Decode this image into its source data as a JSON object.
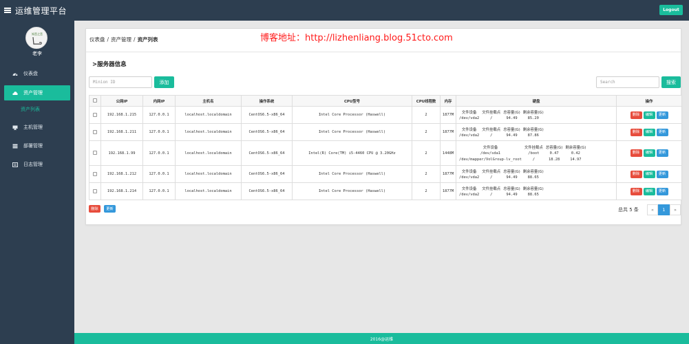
{
  "header": {
    "title": "运维管理平台",
    "logout_label": "Logout"
  },
  "sidebar": {
    "username": "老李",
    "items": [
      {
        "label": "仪表盘",
        "icon": "dashboard-icon"
      },
      {
        "label": "资产管理",
        "icon": "cloud-icon",
        "sub": "资产列表"
      },
      {
        "label": "主机管理",
        "icon": "desktop-icon"
      },
      {
        "label": "部署管理",
        "icon": "deploy-icon"
      },
      {
        "label": "日志管理",
        "icon": "log-icon"
      }
    ]
  },
  "breadcrumb": [
    "仪表盘",
    "资产管理",
    "资产列表"
  ],
  "blog_url": "博客地址：http://lizhenliang.blog.51cto.com",
  "section_title": ">服务器信息",
  "minion_input": {
    "placeholder": "Minion ID"
  },
  "add_label": "添加",
  "search_input": {
    "placeholder": "Search"
  },
  "search_label": "搜索",
  "table": {
    "columns": [
      "公网IP",
      "内网IP",
      "主机名",
      "操作系统",
      "CPU型号",
      "CPU线程数",
      "内存",
      "硬盘",
      "操作"
    ],
    "disk_headers": [
      "文件设备",
      "文件挂载点",
      "总容量(G)",
      "剩余容量(G)"
    ],
    "actions": {
      "delete": "删除",
      "edit": "编辑",
      "update": "更新"
    },
    "rows": [
      {
        "public_ip": "192.168.1.215",
        "private_ip": "127.0.0.1",
        "hostname": "localhost.localdomain",
        "os": "CentOS6.5-x86_64",
        "cpu": "Intel Core Processor (Haswell)",
        "threads": "2",
        "mem": "1877M",
        "disks": [
          {
            "dev": "/dev/vda2",
            "mount": "/",
            "total": "94.49",
            "free": "85.20"
          }
        ]
      },
      {
        "public_ip": "192.168.1.211",
        "private_ip": "127.0.0.1",
        "hostname": "localhost.localdomain",
        "os": "CentOS6.5-x86_64",
        "cpu": "Intel Core Processor (Haswell)",
        "threads": "2",
        "mem": "1877M",
        "disks": [
          {
            "dev": "/dev/vda2",
            "mount": "/",
            "total": "94.49",
            "free": "87.86"
          }
        ]
      },
      {
        "public_ip": "192.168.1.99",
        "private_ip": "127.0.0.1",
        "hostname": "localhost.localdomain",
        "os": "CentOS6.5-x86_64",
        "cpu": "Intel(R) Core(TM) i5-4460 CPU @ 3.20GHz",
        "threads": "2",
        "mem": "1448M",
        "disks": [
          {
            "dev": "/dev/sda1",
            "mount": "/boot",
            "total": "0.47",
            "free": "0.42"
          },
          {
            "dev": "/dev/mapper/VolGroup-lv_root",
            "mount": "/",
            "total": "18.28",
            "free": "14.97"
          }
        ]
      },
      {
        "public_ip": "192.168.1.212",
        "private_ip": "127.0.0.1",
        "hostname": "localhost.localdomain",
        "os": "CentOS6.5-x86_64",
        "cpu": "Intel Core Processor (Haswell)",
        "threads": "2",
        "mem": "1877M",
        "disks": [
          {
            "dev": "/dev/vda2",
            "mount": "/",
            "total": "94.49",
            "free": "88.65"
          }
        ]
      },
      {
        "public_ip": "192.168.1.214",
        "private_ip": "127.0.0.1",
        "hostname": "localhost.localdomain",
        "os": "CentOS6.5-x86_64",
        "cpu": "Intel Core Processor (Haswell)",
        "threads": "2",
        "mem": "1877M",
        "disks": [
          {
            "dev": "/dev/vda2",
            "mount": "/",
            "total": "94.49",
            "free": "88.65"
          }
        ]
      }
    ]
  },
  "bulk": {
    "delete": "删除",
    "update": "更新"
  },
  "pagination": {
    "total": "总共 5 条",
    "prev": "«",
    "page": "1",
    "next": "»"
  },
  "footer": "2016@运维"
}
